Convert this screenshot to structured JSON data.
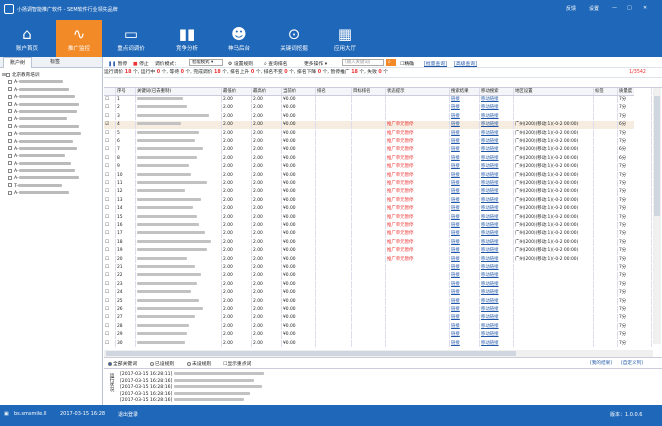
{
  "window": {
    "title": "小扬调智能推广软件 - SEM软件行业领先品牌",
    "feedback": "反馈",
    "settings": "设置",
    "accent": "#1f67b8",
    "active_color": "#f28a28"
  },
  "nav": [
    {
      "label": "账户首页",
      "icon": "home-icon"
    },
    {
      "label": "推广监控",
      "icon": "monitor-icon"
    },
    {
      "label": "重点词调价",
      "icon": "price-icon"
    },
    {
      "label": "竞争分析",
      "icon": "bar-chart-icon"
    },
    {
      "label": "神马后台",
      "icon": "mascot-icon"
    },
    {
      "label": "关键词挖掘",
      "icon": "keyword-icon"
    },
    {
      "label": "应用大厅",
      "icon": "apps-icon"
    }
  ],
  "left": {
    "tabs": [
      "账户树",
      "标签"
    ],
    "root_label": "北京教育培训",
    "nodes": [
      "A-",
      "A-",
      "A-",
      "A-",
      "A-",
      "A-",
      "A-",
      "A-",
      "A-",
      "A-",
      "A-",
      "A-",
      "A-",
      "A-",
      "T-",
      "A-"
    ]
  },
  "toolbar": {
    "pause": "暂停",
    "stop": "停止",
    "mode_label": "调价模式：",
    "mode_value": "智能模式",
    "rules": "设置规则",
    "query_rank": "查询排名",
    "more": "更多操作",
    "search_placeholder": "(输入关键词)",
    "exact": "精确",
    "batch_query": "[批量查询]",
    "advanced_query": "[高级查询]"
  },
  "stats": {
    "text_a": "运行调价",
    "running_total": "18",
    "text_b": "个, 运行中",
    "running": "0",
    "text_c": "个, 等待",
    "waiting": "0",
    "text_d": "个, 完成调价",
    "done": "18",
    "text_e": "个, 排名上升",
    "up": "0",
    "text_f": "个, 排名不变",
    "same": "0",
    "text_g": "个, 排名下降",
    "down": "0",
    "text_h": "个, 暂停推广",
    "paused": "18",
    "text_i": "个, 失败",
    "failed": "0",
    "text_j": "个",
    "page": "1/3542"
  },
  "columns": [
    "序号",
    "关键词(已去重制)",
    "最低价",
    "最高价",
    "当前价",
    "排名",
    "目标排名",
    "状态提示",
    "搜索结果",
    "移动搜索",
    "地区设置",
    "标签",
    "质量度"
  ],
  "rows": [
    {
      "no": "1",
      "min": "2.00",
      "max": "2.00",
      "price": "¥0.00",
      "status": "",
      "search": "链接",
      "mobile": "移动链接",
      "region": "",
      "quality": "7分"
    },
    {
      "no": "2",
      "min": "2.00",
      "max": "2.00",
      "price": "¥0.00",
      "status": "",
      "search": "链接",
      "mobile": "移动链接",
      "region": "",
      "quality": "7分"
    },
    {
      "no": "3",
      "min": "2.00",
      "max": "2.00",
      "price": "¥0.00",
      "status": "",
      "search": "链接",
      "mobile": "移动链接",
      "region": "",
      "quality": "7分"
    },
    {
      "no": "4",
      "min": "2.00",
      "max": "2.00",
      "price": "¥0.00",
      "status": "推广单元暂停",
      "search": "链接",
      "mobile": "移动链接",
      "region": "广州(200)(移动:1)(-0-2 00:00)",
      "quality": "6分"
    },
    {
      "no": "5",
      "min": "2.00",
      "max": "2.00",
      "price": "¥0.00",
      "status": "推广单元暂停",
      "search": "链接",
      "mobile": "移动链接",
      "region": "广州(200)(移动:1)(-0-2 00:00)",
      "quality": "7分"
    },
    {
      "no": "6",
      "min": "2.00",
      "max": "2.00",
      "price": "¥0.00",
      "status": "推广单元暂停",
      "search": "链接",
      "mobile": "移动链接",
      "region": "广州(200)(移动:1)(-0-2 00:00)",
      "quality": "7分"
    },
    {
      "no": "7",
      "min": "2.00",
      "max": "2.00",
      "price": "¥0.00",
      "status": "推广单元暂停",
      "search": "链接",
      "mobile": "移动链接",
      "region": "广州(200)(移动:1)(-0-2 00:00)",
      "quality": "6分"
    },
    {
      "no": "8",
      "min": "2.00",
      "max": "2.00",
      "price": "¥0.00",
      "status": "推广单元暂停",
      "search": "链接",
      "mobile": "移动链接",
      "region": "广州(200)(移动:1)(-0-2 00:00)",
      "quality": "6分"
    },
    {
      "no": "9",
      "min": "2.00",
      "max": "2.00",
      "price": "¥0.00",
      "status": "推广单元暂停",
      "search": "链接",
      "mobile": "移动链接",
      "region": "广州(200)(移动:1)(-0-2 00:00)",
      "quality": "7分"
    },
    {
      "no": "10",
      "min": "2.00",
      "max": "2.00",
      "price": "¥0.00",
      "status": "推广单元暂停",
      "search": "链接",
      "mobile": "移动链接",
      "region": "广州(200)(移动:1)(-0-2 00:00)",
      "quality": "7分"
    },
    {
      "no": "11",
      "min": "2.00",
      "max": "2.00",
      "price": "¥0.00",
      "status": "推广单元暂停",
      "search": "链接",
      "mobile": "移动链接",
      "region": "广州(200)(移动:1)(-0-2 00:00)",
      "quality": "7分"
    },
    {
      "no": "12",
      "min": "2.00",
      "max": "2.00",
      "price": "¥0.00",
      "status": "推广单元暂停",
      "search": "链接",
      "mobile": "移动链接",
      "region": "广州(200)(移动:1)(-0-2 00:00)",
      "quality": "7分"
    },
    {
      "no": "13",
      "min": "2.00",
      "max": "2.00",
      "price": "¥0.00",
      "status": "推广单元暂停",
      "search": "链接",
      "mobile": "移动链接",
      "region": "广州(200)(移动:1)(-0-2 00:00)",
      "quality": "7分"
    },
    {
      "no": "14",
      "min": "2.00",
      "max": "2.00",
      "price": "¥0.00",
      "status": "推广单元暂停",
      "search": "链接",
      "mobile": "移动链接",
      "region": "广州(200)(移动:1)(-0-2 00:00)",
      "quality": "7分"
    },
    {
      "no": "15",
      "min": "2.00",
      "max": "2.00",
      "price": "¥0.00",
      "status": "推广单元暂停",
      "search": "链接",
      "mobile": "移动链接",
      "region": "广州(200)(移动:1)(-0-2 00:00)",
      "quality": "7分"
    },
    {
      "no": "16",
      "min": "2.00",
      "max": "2.00",
      "price": "¥0.00",
      "status": "推广单元暂停",
      "search": "链接",
      "mobile": "移动链接",
      "region": "广州(200)(移动:1)(-0-2 00:00)",
      "quality": "7分"
    },
    {
      "no": "17",
      "min": "2.00",
      "max": "2.00",
      "price": "¥0.00",
      "status": "推广单元暂停",
      "search": "链接",
      "mobile": "移动链接",
      "region": "广州(200)(移动:1)(-0-2 00:00)",
      "quality": "7分"
    },
    {
      "no": "18",
      "min": "2.00",
      "max": "2.00",
      "price": "¥0.00",
      "status": "推广单元暂停",
      "search": "链接",
      "mobile": "移动链接",
      "region": "广州(200)(移动:1)(-0-2 00:00)",
      "quality": "7分"
    },
    {
      "no": "19",
      "min": "2.00",
      "max": "2.00",
      "price": "¥0.00",
      "status": "推广单元暂停",
      "search": "链接",
      "mobile": "移动链接",
      "region": "广州(200)(移动:1)(-0-2 00:00)",
      "quality": "7分"
    },
    {
      "no": "20",
      "min": "2.00",
      "max": "2.00",
      "price": "¥0.00",
      "status": "推广单元暂停",
      "search": "链接",
      "mobile": "移动链接",
      "region": "广州(200)(移动:1)(-0-2 00:00)",
      "quality": "7分"
    },
    {
      "no": "21",
      "min": "2.00",
      "max": "2.00",
      "price": "¥0.00",
      "status": "",
      "search": "链接",
      "mobile": "移动链接",
      "region": "",
      "quality": "7分"
    },
    {
      "no": "22",
      "min": "2.00",
      "max": "2.00",
      "price": "¥0.00",
      "status": "",
      "search": "链接",
      "mobile": "移动链接",
      "region": "",
      "quality": "7分"
    },
    {
      "no": "23",
      "min": "2.00",
      "max": "2.00",
      "price": "¥0.00",
      "status": "",
      "search": "链接",
      "mobile": "移动链接",
      "region": "",
      "quality": "7分"
    },
    {
      "no": "24",
      "min": "2.00",
      "max": "2.00",
      "price": "¥0.00",
      "status": "",
      "search": "链接",
      "mobile": "移动链接",
      "region": "",
      "quality": "7分"
    },
    {
      "no": "25",
      "min": "2.00",
      "max": "2.00",
      "price": "¥0.00",
      "status": "",
      "search": "链接",
      "mobile": "移动链接",
      "region": "",
      "quality": "7分"
    },
    {
      "no": "26",
      "min": "2.00",
      "max": "2.00",
      "price": "¥0.00",
      "status": "",
      "search": "链接",
      "mobile": "移动链接",
      "region": "",
      "quality": "7分"
    },
    {
      "no": "27",
      "min": "2.00",
      "max": "2.00",
      "price": "¥0.00",
      "status": "",
      "search": "链接",
      "mobile": "移动链接",
      "region": "",
      "quality": "7分"
    },
    {
      "no": "28",
      "min": "2.00",
      "max": "2.00",
      "price": "¥0.00",
      "status": "",
      "search": "链接",
      "mobile": "移动链接",
      "region": "",
      "quality": "7分"
    },
    {
      "no": "29",
      "min": "2.00",
      "max": "2.00",
      "price": "¥0.00",
      "status": "",
      "search": "链接",
      "mobile": "移动链接",
      "region": "",
      "quality": "7分"
    },
    {
      "no": "30",
      "min": "2.00",
      "max": "2.00",
      "price": "¥0.00",
      "status": "",
      "search": "链接",
      "mobile": "移动链接",
      "region": "",
      "quality": "7分"
    }
  ],
  "filters": {
    "all": "全部关键词",
    "configured": "已设规则",
    "unconfigured": "未设规则",
    "show_focus": "显示重点词",
    "my_results": "[我的结果]",
    "customize": "[自定义列]"
  },
  "log": {
    "side_label": "运行状况",
    "lines": [
      "[2017-03-15 16:28:11]",
      "[2017-03-15 16:28:16]",
      "[2017-03-15 16:28:16]",
      "[2017-03-15 16:28:16]",
      "[2017-03-15 16:28:16]"
    ]
  },
  "statusbar": {
    "account": "bs.smsmile.ll",
    "datetime": "2017-03-15 16:28",
    "login": "退出登录",
    "version": "版本：1.0.0.6"
  }
}
